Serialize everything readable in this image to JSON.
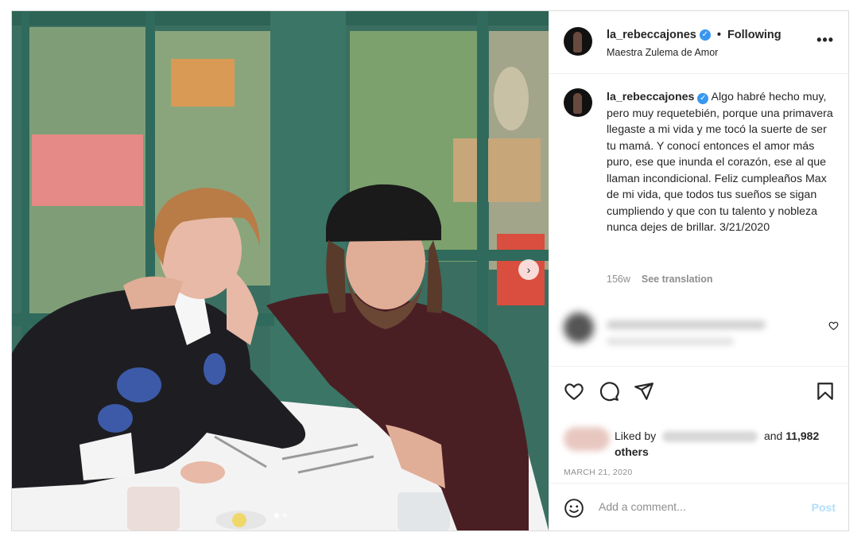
{
  "header": {
    "username": "la_rebeccajones",
    "separator": "•",
    "follow_status": "Following",
    "subtitle": "Maestra Zulema de Amor"
  },
  "caption": {
    "username": "la_rebeccajones",
    "text": "Algo habré hecho muy, pero muy requetebién, porque una primavera llegaste a mi vida y me tocó la suerte de ser tu mamá. Y conocí entonces el amor más puro, ese que inunda el corazón, ese al que llaman incondicional. Feliz cumpleaños Max de mi vida, que todos tus sueños se sigan cumpliendo y que con tu talento y nobleza nunca dejes de brillar. 3/21/2020",
    "age": "156w",
    "translate_label": "See translation"
  },
  "likes": {
    "prefix": "Liked by",
    "and_label": "and",
    "count": "11,982",
    "others_label": "others"
  },
  "post_date": "MARCH 21, 2020",
  "comment_box": {
    "placeholder": "Add a comment...",
    "post_label": "Post"
  },
  "carousel": {
    "count": 2,
    "active_index": 0
  },
  "icons": {
    "more": "more-options-icon",
    "like": "heart-icon",
    "comment": "comment-icon",
    "share": "share-icon",
    "save": "bookmark-icon",
    "emoji": "emoji-icon",
    "verified": "verified-badge-icon"
  },
  "colors": {
    "verified": "#3897f0",
    "post_disabled": "#b2dffc",
    "muted_text": "#8e8e8e",
    "border": "#dbdbdb"
  }
}
